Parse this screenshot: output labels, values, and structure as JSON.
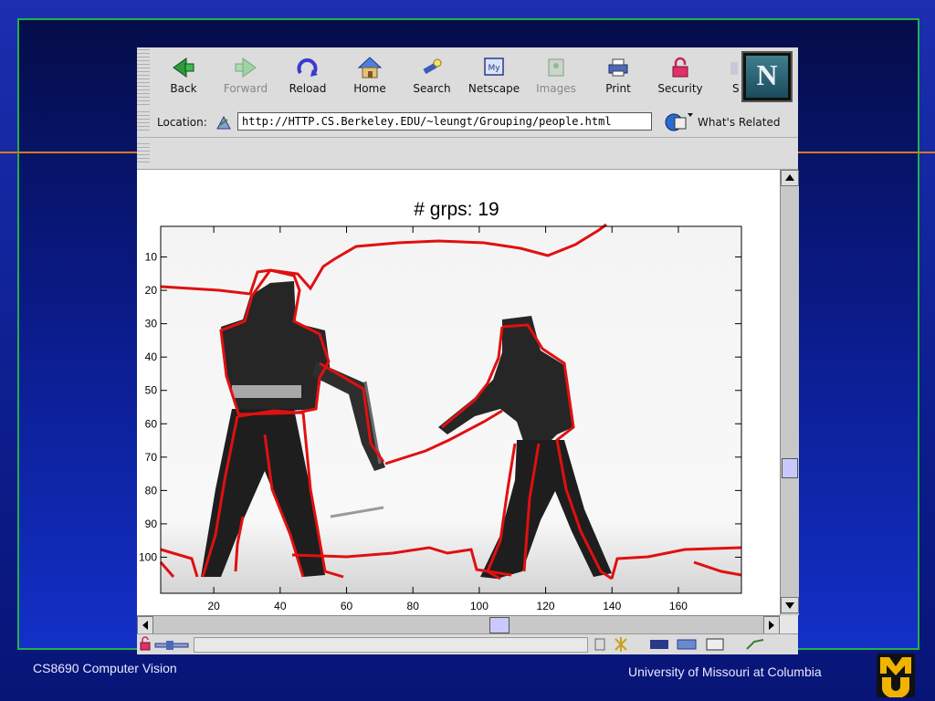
{
  "toolbar": {
    "buttons": [
      {
        "label": "Back"
      },
      {
        "label": "Forward"
      },
      {
        "label": "Reload"
      },
      {
        "label": "Home"
      },
      {
        "label": "Search"
      },
      {
        "label": "Netscape"
      },
      {
        "label": "Images"
      },
      {
        "label": "Print"
      },
      {
        "label": "Security"
      },
      {
        "label": "S"
      }
    ],
    "logo_letter": "N"
  },
  "location": {
    "label": "Location:",
    "url": "http://HTTP.CS.Berkeley.EDU/~leungt/Grouping/people.html",
    "related_label": "What's Related"
  },
  "figure": {
    "title": "# grps: 19",
    "x_ticks": [
      "20",
      "40",
      "60",
      "80",
      "100",
      "120",
      "140",
      "160"
    ],
    "y_ticks": [
      "10",
      "20",
      "30",
      "40",
      "50",
      "60",
      "70",
      "80",
      "90",
      "100"
    ]
  },
  "footer": {
    "left": "CS8690 Computer Vision",
    "right": "University of Missouri at Columbia"
  },
  "colors": {
    "segment_boundary": "#e01010",
    "accent_rule": "#d27a1e",
    "frame_border": "#22b04b",
    "logo_gold": "#f0b400"
  }
}
